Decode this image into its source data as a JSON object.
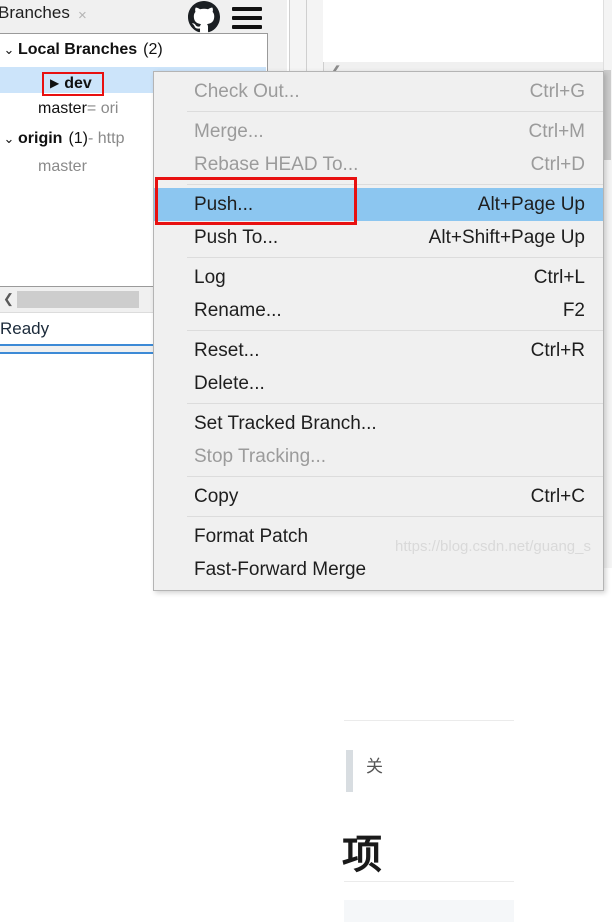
{
  "github_panel": {
    "tab": {
      "label": "Branches",
      "close_icon": "×"
    },
    "icons": {
      "octocat": "github-octocat-icon",
      "menu": "hamburger-menu-icon"
    },
    "tree": [
      {
        "chevron": "⌄",
        "label": "Local Branches",
        "count": "(2)",
        "type": "group"
      },
      {
        "marker": "▶",
        "label": "dev",
        "type": "branch-selected"
      },
      {
        "label": "master",
        "suffix": " = ori",
        "type": "branch"
      },
      {
        "chevron": "⌄",
        "label": "origin",
        "count": "(1)",
        "suffix": " - http",
        "type": "group"
      },
      {
        "label": "master",
        "type": "remote-branch"
      }
    ],
    "hscroll": {
      "left_arrow": "❮"
    },
    "status": {
      "text": "Ready"
    }
  },
  "editor_pane": {
    "collapse_chevron": "❮"
  },
  "context_menu": {
    "items": [
      {
        "label": "Check Out...",
        "accel": "Ctrl+G",
        "disabled": true,
        "separator_after": true
      },
      {
        "label": "Merge...",
        "accel": "Ctrl+M",
        "disabled": true
      },
      {
        "label": "Rebase HEAD To...",
        "accel": "Ctrl+D",
        "disabled": true,
        "separator_after": true
      },
      {
        "label": "Push...",
        "accel": "Alt+Page Up",
        "highlighted": true
      },
      {
        "label": "Push To...",
        "accel": "Alt+Shift+Page Up",
        "separator_after": true
      },
      {
        "label": "Log",
        "accel": "Ctrl+L"
      },
      {
        "label": "Rename...",
        "accel": "F2",
        "separator_after": true
      },
      {
        "label": "Reset...",
        "accel": "Ctrl+R"
      },
      {
        "label": "Delete...",
        "accel": "",
        "separator_after": true
      },
      {
        "label": "Set Tracked Branch...",
        "accel": ""
      },
      {
        "label": "Stop Tracking...",
        "accel": "",
        "disabled": true,
        "separator_after": true
      },
      {
        "label": "Copy",
        "accel": "Ctrl+C",
        "separator_after": true
      },
      {
        "label": "Format Patch",
        "accel": ""
      },
      {
        "label": "Fast-Forward Merge",
        "accel": ""
      }
    ]
  },
  "document": {
    "quote_text": "关",
    "heading": "项"
  },
  "watermark": {
    "text": "https://blog.csdn.net/guang_s"
  },
  "colors": {
    "highlight_blue": "#8cc6f0",
    "selection_blue": "#cce4fa",
    "annotation_red": "#e81010",
    "menu_bg": "#f0f0f0",
    "accent_blue": "#3d8ad6"
  }
}
